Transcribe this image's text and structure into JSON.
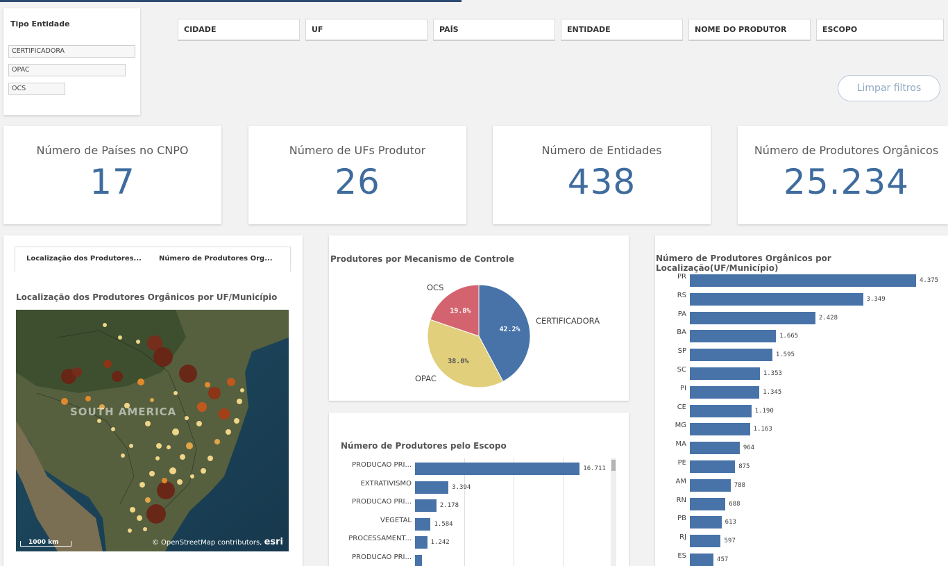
{
  "tipo_entidade": {
    "title": "Tipo Entidade",
    "items": [
      "CERTIFICADORA",
      "OPAC",
      "OCS"
    ]
  },
  "filters": [
    "CIDADE",
    "UF",
    "PAÍS",
    "ENTIDADE",
    "NOME DO PRODUTOR",
    "ESCOPO"
  ],
  "limpar_label": "Limpar filtros",
  "kpis": [
    {
      "label": "Número de Países no CNPO",
      "value": "17"
    },
    {
      "label": "Número de UFs Produtor",
      "value": "26"
    },
    {
      "label": "Número de Entidades",
      "value": "438"
    },
    {
      "label": "Número de Produtores Orgânicos",
      "value": "25.234"
    }
  ],
  "map_panel": {
    "tabs": [
      "Localização dos Produtores...",
      "Número de Produtores Org..."
    ],
    "title": "Localização dos Produtores Orgânicos por UF/Município",
    "continent_label": "SOUTH AMERICA",
    "scale": "1000 km",
    "attribution": "© OpenStreetMap contributors,",
    "attribution_brand": "esri"
  },
  "colors": {
    "accent": "#3f6c9e",
    "bar": "#4773a8",
    "pie_certificadora": "#4773a8",
    "pie_opac": "#e1cf7c",
    "pie_ocs": "#d3646f"
  },
  "chart_data": [
    {
      "type": "pie",
      "title": "Produtores por Mecanismo de Controle",
      "categories": [
        "CERTIFICADORA",
        "OPAC",
        "OCS"
      ],
      "values": [
        42.2,
        38.0,
        19.8
      ],
      "value_labels": [
        "42.2%",
        "38.0%",
        "19.8%"
      ]
    },
    {
      "type": "bar",
      "orientation": "horizontal",
      "title": "Número de Produtores pelo Escopo",
      "categories": [
        "PRODUCAO PRI...",
        "EXTRATIVISMO",
        "PRODUCAO PRI...",
        "VEGETAL",
        "PROCESSAMENT...",
        "PRODUCAO PRI..."
      ],
      "values": [
        16711,
        3394,
        2178,
        1584,
        1242,
        700
      ],
      "value_labels": [
        "16.711",
        "3.394",
        "2.178",
        "1.584",
        "1.242",
        ""
      ],
      "xlim": [
        0,
        20000
      ]
    },
    {
      "type": "bar",
      "orientation": "horizontal",
      "title": "Número de Produtores Orgânicos por Localização(UF/Município)",
      "categories": [
        "PR",
        "RS",
        "PA",
        "BA",
        "SP",
        "SC",
        "PI",
        "CE",
        "MG",
        "MA",
        "PE",
        "AM",
        "RN",
        "PB",
        "RJ",
        "ES"
      ],
      "values": [
        4375,
        3349,
        2428,
        1665,
        1595,
        1353,
        1345,
        1190,
        1163,
        964,
        875,
        788,
        688,
        613,
        597,
        457
      ],
      "value_labels": [
        "4.375",
        "3.349",
        "2.428",
        "1.665",
        "1.595",
        "1.353",
        "1.345",
        "1.190",
        "1.163",
        "964",
        "875",
        "788",
        "688",
        "613",
        "597",
        "457"
      ],
      "xlim": [
        0,
        4375
      ]
    }
  ]
}
